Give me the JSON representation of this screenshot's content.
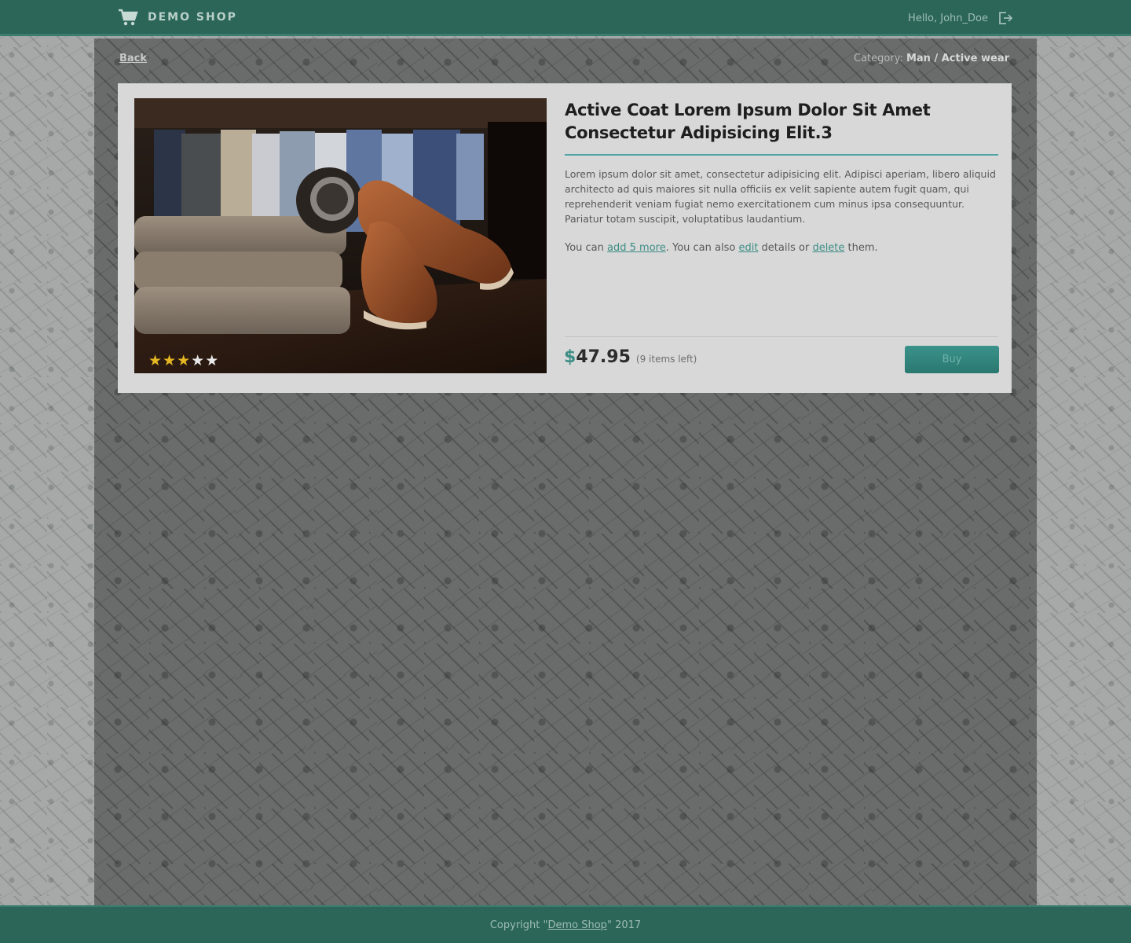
{
  "header": {
    "brand": "DEMO SHOP",
    "greeting": "Hello, John_Doe",
    "icons": {
      "cart": "cart-icon",
      "logout": "logout-icon"
    }
  },
  "nav": {
    "back_label": "Back",
    "category_label": "Category:",
    "category_path": "Man / Active wear"
  },
  "product": {
    "title": "Active Coat Lorem Ipsum Dolor Sit Amet Consectetur Adipisicing Elit.3",
    "description": "Lorem ipsum dolor sit amet, consectetur adipisicing elit. Adipisci aperiam, libero aliquid architecto ad quis maiores sit nulla officiis ex velit sapiente autem fugit quam, qui reprehenderit veniam fugiat nemo exercitationem cum minus ipsa consequuntur. Pariatur totam suscipit, voluptatibus laudantium.",
    "actions": {
      "text_1": "You can ",
      "add_link": "add 5 more",
      "text_2": ". You can also ",
      "edit_link": "edit",
      "text_3": " details or ",
      "delete_link": "delete",
      "text_4": " them."
    },
    "currency": "$",
    "price": "47.95",
    "stock": "(9 items left)",
    "buy_label": "Buy",
    "rating": 3,
    "rating_max": 5
  },
  "footer": {
    "prefix": "Copyright \"",
    "brand_link": "Demo Shop",
    "suffix": "\" 2017"
  },
  "colors": {
    "header_bg": "#2b6659",
    "accent": "#3d8e86",
    "star": "#e4b623"
  }
}
